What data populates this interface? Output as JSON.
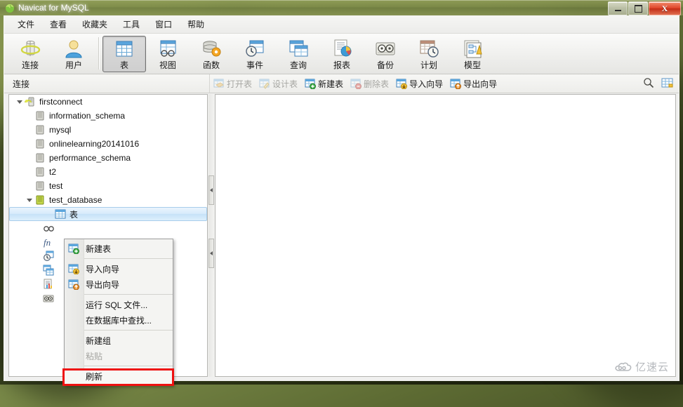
{
  "window": {
    "title": "Navicat for MySQL",
    "title_icon": "navicat-leaf-icon",
    "controls": {
      "minimize": "minimize-button",
      "maximize": "maximize-button",
      "close": "close-button",
      "close_glyph": "X"
    }
  },
  "menubar": {
    "items": [
      {
        "label": "文件"
      },
      {
        "label": "查看"
      },
      {
        "label": "收藏夹"
      },
      {
        "label": "工具"
      },
      {
        "label": "窗口"
      },
      {
        "label": "帮助"
      }
    ]
  },
  "toolbar": {
    "buttons": [
      {
        "label": "连接",
        "icon": "connection-icon",
        "pressed": false
      },
      {
        "label": "用户",
        "icon": "user-icon",
        "pressed": false
      },
      {
        "label": "表",
        "icon": "table-icon",
        "pressed": true
      },
      {
        "label": "视图",
        "icon": "view-icon",
        "pressed": false
      },
      {
        "label": "函数",
        "icon": "function-icon",
        "pressed": false
      },
      {
        "label": "事件",
        "icon": "event-icon",
        "pressed": false
      },
      {
        "label": "查询",
        "icon": "query-icon",
        "pressed": false
      },
      {
        "label": "报表",
        "icon": "report-icon",
        "pressed": false
      },
      {
        "label": "备份",
        "icon": "backup-icon",
        "pressed": false
      },
      {
        "label": "计划",
        "icon": "schedule-icon",
        "pressed": false
      },
      {
        "label": "模型",
        "icon": "model-icon",
        "pressed": false
      }
    ]
  },
  "strip": {
    "label": "连接",
    "actions": [
      {
        "label": "打开表",
        "icon": "open-table-icon",
        "enabled": false
      },
      {
        "label": "设计表",
        "icon": "design-table-icon",
        "enabled": false
      },
      {
        "label": "新建表",
        "icon": "new-table-icon",
        "enabled": true
      },
      {
        "label": "删除表",
        "icon": "delete-table-icon",
        "enabled": false
      },
      {
        "label": "导入向导",
        "icon": "import-wizard-icon",
        "enabled": true
      },
      {
        "label": "导出向导",
        "icon": "export-wizard-icon",
        "enabled": true
      }
    ],
    "right_icons": [
      {
        "name": "search-icon"
      },
      {
        "name": "grid-view-icon"
      }
    ]
  },
  "tree": {
    "nodes": [
      {
        "label": "firstconnect",
        "icon": "connection-node-icon",
        "depth": 0,
        "expanded": true,
        "selected": false
      },
      {
        "label": "information_schema",
        "icon": "database-grey-icon",
        "depth": 1,
        "expanded": null,
        "selected": false
      },
      {
        "label": "mysql",
        "icon": "database-grey-icon",
        "depth": 1,
        "expanded": null,
        "selected": false
      },
      {
        "label": "onlinelearning20141016",
        "icon": "database-grey-icon",
        "depth": 1,
        "expanded": null,
        "selected": false
      },
      {
        "label": "performance_schema",
        "icon": "database-grey-icon",
        "depth": 1,
        "expanded": null,
        "selected": false
      },
      {
        "label": "t2",
        "icon": "database-grey-icon",
        "depth": 1,
        "expanded": null,
        "selected": false
      },
      {
        "label": "test",
        "icon": "database-grey-icon",
        "depth": 1,
        "expanded": null,
        "selected": false
      },
      {
        "label": "test_database",
        "icon": "database-open-icon",
        "depth": 1,
        "expanded": true,
        "selected": false
      },
      {
        "label": "表",
        "icon": "table-node-icon",
        "depth": 2,
        "expanded": null,
        "selected": true
      }
    ],
    "obscured_children": [
      {
        "icon": "view-node-icon"
      },
      {
        "icon": "function-node-icon"
      },
      {
        "icon": "event-node-icon"
      },
      {
        "icon": "query-node-icon"
      },
      {
        "icon": "report-node-icon"
      },
      {
        "icon": "backup-node-icon"
      }
    ]
  },
  "context_menu": {
    "items": [
      {
        "label": "新建表",
        "icon": "new-table-icon",
        "enabled": true,
        "separator_after": true
      },
      {
        "label": "导入向导",
        "icon": "import-wizard-icon",
        "enabled": true,
        "separator_after": false
      },
      {
        "label": "导出向导",
        "icon": "export-wizard-icon",
        "enabled": true,
        "separator_after": true
      },
      {
        "label": "运行 SQL 文件...",
        "icon": null,
        "enabled": true,
        "separator_after": false
      },
      {
        "label": "在数据库中查找...",
        "icon": null,
        "enabled": true,
        "separator_after": true
      },
      {
        "label": "新建组",
        "icon": null,
        "enabled": true,
        "separator_after": false
      },
      {
        "label": "粘贴",
        "icon": null,
        "enabled": false,
        "separator_after": true
      },
      {
        "label": "刷新",
        "icon": null,
        "enabled": true,
        "separator_after": false,
        "highlighted": true
      }
    ]
  },
  "annotation": {
    "type": "red-rectangle",
    "color": "#ee1111",
    "targets": "刷新"
  },
  "watermark": {
    "text": "亿速云",
    "icon": "cloud-icon"
  },
  "colors": {
    "accent": "#c6e2f8",
    "annotation": "#ee1111",
    "titlebar": "#8c9a54",
    "close_button": "#d8391c"
  }
}
